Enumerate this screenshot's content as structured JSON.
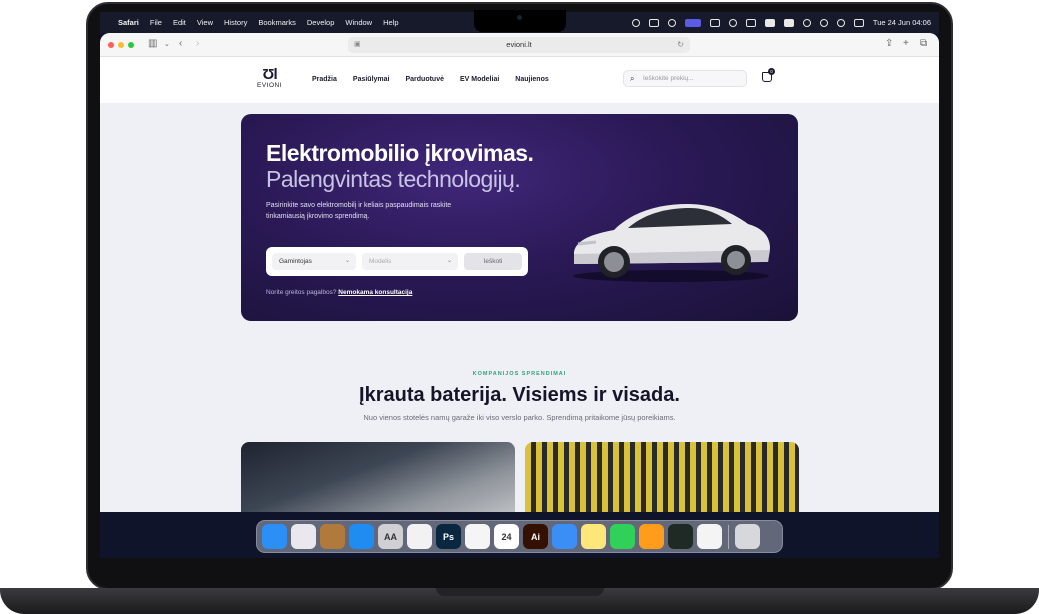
{
  "menubar": {
    "app_name": "Safari",
    "items": [
      "File",
      "Edit",
      "View",
      "History",
      "Bookmarks",
      "Develop",
      "Window",
      "Help"
    ],
    "clock": "Tue 24 Jun  04:06"
  },
  "browser": {
    "url": "evioni.lt"
  },
  "site": {
    "logo_mark": "Ʊl",
    "logo_text": "EVIONI",
    "nav": [
      "Pradžia",
      "Pasiūlymai",
      "Parduotuvė",
      "EV Modeliai",
      "Naujienos"
    ],
    "search_placeholder": "Ieškokite prekių...",
    "cart_count": "0"
  },
  "hero": {
    "title": "Elektromobilio įkrovimas.",
    "subtitle": "Palengvintas technologijų.",
    "description": "Pasirinkite savo elektromobilį ir keliais paspaudimais raskite tinkamiausią įkrovimo sprendimą.",
    "manufacturer_label": "Gamintojas",
    "model_label": "Modelis",
    "search_button": "Ieškoti",
    "help_text": "Norite greitos pagalbos?",
    "help_link": "Nemokama konsultacija"
  },
  "solutions": {
    "kicker": "KOMPANIJOS SPRENDIMAI",
    "title": "Įkrauta baterija. Visiems ir visada.",
    "subtitle": "Nuo vienos stotelės namų garaže iki viso verslo parko. Sprendimą pritaikome jūsų poreikiams."
  },
  "dock": {
    "apps": [
      {
        "name": "finder-icon",
        "label": "",
        "color": "#2c8ff5"
      },
      {
        "name": "launchpad-icon",
        "label": "",
        "color": "#e8e8ee"
      },
      {
        "name": "guitar-icon",
        "label": "",
        "color": "#b07a3c"
      },
      {
        "name": "safari-icon",
        "label": "",
        "color": "#1e8cf0"
      },
      {
        "name": "font-book-icon",
        "label": "AA",
        "color": "#cfcfd4"
      },
      {
        "name": "photos-icon",
        "label": "",
        "color": "#f2f2f2"
      },
      {
        "name": "photoshop-icon",
        "label": "Ps",
        "color": "#0a2740"
      },
      {
        "name": "reminders-icon",
        "label": "",
        "color": "#f5f5f5"
      },
      {
        "name": "calendar-icon",
        "label": "24",
        "color": "#ffffff"
      },
      {
        "name": "illustrator-icon",
        "label": "Ai",
        "color": "#331000"
      },
      {
        "name": "mail-icon",
        "label": "",
        "color": "#3a8ef6"
      },
      {
        "name": "notes-icon",
        "label": "",
        "color": "#fde77a"
      },
      {
        "name": "whatsapp-icon",
        "label": "",
        "color": "#2fd158"
      },
      {
        "name": "pages-icon",
        "label": "",
        "color": "#ff9c1c"
      },
      {
        "name": "activity-monitor-icon",
        "label": "",
        "color": "#1f2a24"
      },
      {
        "name": "chrome-icon",
        "label": "",
        "color": "#f4f4f4"
      },
      {
        "name": "trash-icon",
        "label": "",
        "color": "#d6d8dc"
      }
    ]
  }
}
